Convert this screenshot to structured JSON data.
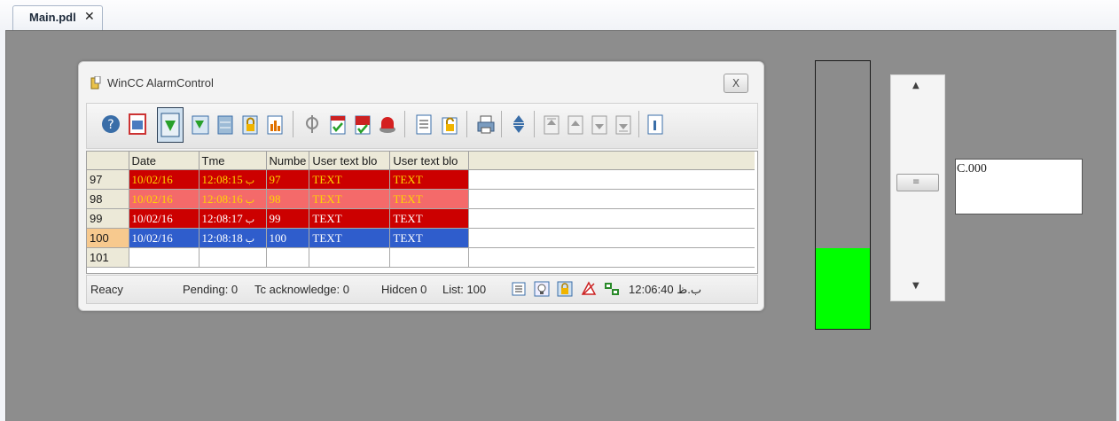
{
  "tabs": [
    {
      "label": "Main.pdl",
      "close": "✕"
    }
  ],
  "alarm_control": {
    "title": "WinCC AlarmControl",
    "close_glyph": "X",
    "columns": [
      "",
      "Date",
      "Tme",
      "Numbe",
      "User text blo",
      "User text blo"
    ],
    "rows": [
      {
        "id": "97",
        "date": "10/02/16",
        "time": "12:08:15",
        "mark": "ب",
        "number": "97",
        "text1": "TEXT",
        "text2": "TEXT",
        "bg": "#cc0000",
        "fg": "#ffd400",
        "selected": false
      },
      {
        "id": "98",
        "date": "10/02/16",
        "time": "12:08:16",
        "mark": "ب",
        "number": "98",
        "text1": "TEXT",
        "text2": "TEXT",
        "bg": "#f46a6a",
        "fg": "#ffd400",
        "selected": false
      },
      {
        "id": "99",
        "date": "10/02/16",
        "time": "12:08:17",
        "mark": "ب",
        "number": "99",
        "text1": "TEXT",
        "text2": "TEXT",
        "bg": "#cc0000",
        "fg": "#ffffff",
        "selected": false
      },
      {
        "id": "100",
        "date": "10/02/16",
        "time": "12:08:18",
        "mark": "ب",
        "number": "100",
        "text1": "TEXT",
        "text2": "TEXT",
        "bg": "#2f5dcc",
        "fg": "#ffffff",
        "selected": true
      }
    ],
    "partial_row_id": "101",
    "status": {
      "state": "Reacy",
      "pending": "Pending: 0",
      "to_ack": "Tc acknowledge: 0",
      "hidden": "Hidcen 0",
      "list": "List: 100",
      "clock": "12:06:40 ب.ظ"
    },
    "toolbar_icons": [
      "help-icon",
      "toggle-view-icon",
      "select-icon",
      "refresh-icon",
      "server-icon",
      "lock-icon",
      "chart-icon",
      "loop-icon",
      "ack-single-icon",
      "ack-group-icon",
      "emergency-ack-icon",
      "lock-list-icon",
      "unlock-list-icon",
      "print-icon",
      "sort-icon",
      "first-icon",
      "prev-icon",
      "next-icon",
      "last-icon",
      "info-icon"
    ],
    "status_icons": [
      "list-icon",
      "bulb-icon",
      "lock-status-icon",
      "no-alarm-icon",
      "server-status-icon"
    ]
  },
  "level_bar": {
    "fill_fraction": 0.3,
    "fill_color": "#00ff00",
    "frame_color": "#8c8c8c"
  },
  "scrollbar": {
    "up": "▲",
    "down": "▼",
    "position_fraction": 0.47
  },
  "value_field": {
    "value": "C.000"
  }
}
